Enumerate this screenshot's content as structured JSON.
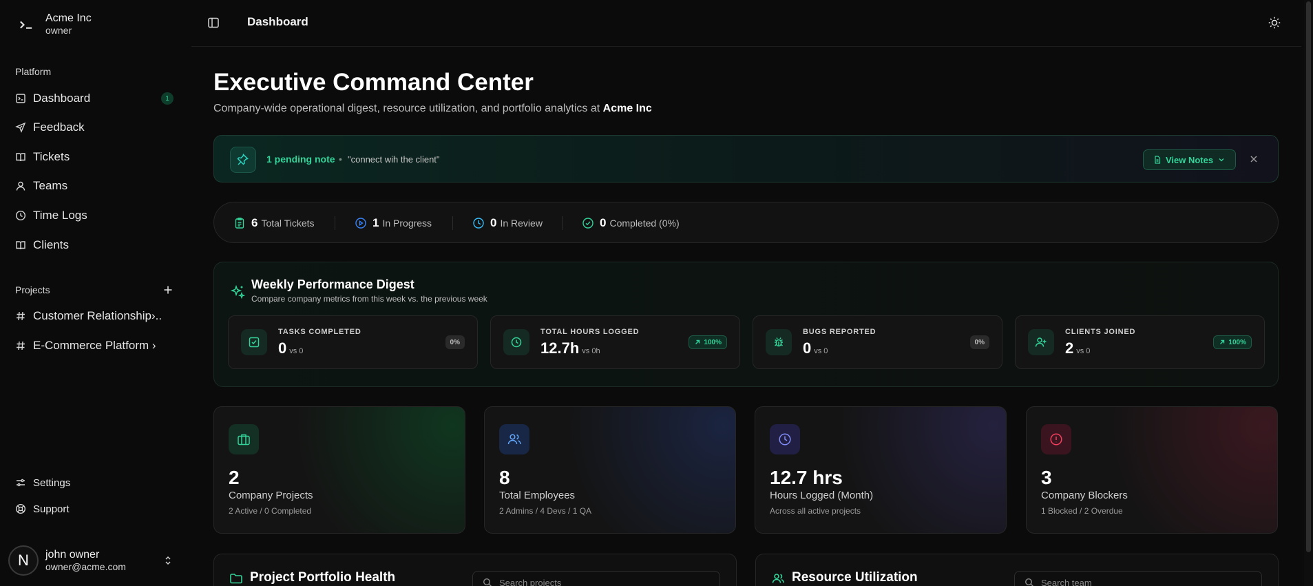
{
  "sidebar": {
    "brand": {
      "name": "Acme Inc",
      "role": "owner"
    },
    "platform_label": "Platform",
    "nav": [
      {
        "label": "Dashboard",
        "icon": "dashboard-icon",
        "badge": "1"
      },
      {
        "label": "Feedback",
        "icon": "send-icon"
      },
      {
        "label": "Tickets",
        "icon": "book-icon"
      },
      {
        "label": "Teams",
        "icon": "user-icon"
      },
      {
        "label": "Time Logs",
        "icon": "clock-icon"
      },
      {
        "label": "Clients",
        "icon": "book-icon"
      }
    ],
    "projects_label": "Projects",
    "projects": [
      {
        "label": "Customer Relationship›.."
      },
      {
        "label": "E-Commerce Platform ›"
      }
    ],
    "footer": [
      {
        "label": "Settings",
        "icon": "settings-icon"
      },
      {
        "label": "Support",
        "icon": "support-icon"
      }
    ],
    "user": {
      "initial": "N",
      "name": "john owner",
      "email": "owner@acme.com"
    }
  },
  "topbar": {
    "title": "Dashboard"
  },
  "header": {
    "title": "Executive Command Center",
    "subtitle_prefix": "Company-wide operational digest, resource utilization, and portfolio analytics at ",
    "subtitle_company": "Acme Inc"
  },
  "notes": {
    "count_text": "1 pending note",
    "separator": "•",
    "preview": "\"connect wih the client\"",
    "button_label": "View Notes"
  },
  "ticket_stats": [
    {
      "value": "6",
      "label": "Total Tickets",
      "color": "#34d399"
    },
    {
      "value": "1",
      "label": "In Progress",
      "color": "#3b82f6"
    },
    {
      "value": "0",
      "label": "In Review",
      "color": "#38bdf8"
    },
    {
      "value": "0",
      "label": "Completed (0%)",
      "color": "#34d399"
    }
  ],
  "digest": {
    "title": "Weekly Performance Digest",
    "subtitle": "Compare company metrics from this week vs. the previous week",
    "metrics": [
      {
        "label": "TASKS COMPLETED",
        "value": "0",
        "vs": "vs 0",
        "change": "0%",
        "trend": "neutral"
      },
      {
        "label": "TOTAL HOURS LOGGED",
        "value": "12.7h",
        "vs": "vs 0h",
        "change": "100%",
        "trend": "up"
      },
      {
        "label": "BUGS REPORTED",
        "value": "0",
        "vs": "vs 0",
        "change": "0%",
        "trend": "neutral"
      },
      {
        "label": "CLIENTS JOINED",
        "value": "2",
        "vs": "vs 0",
        "change": "100%",
        "trend": "up"
      }
    ]
  },
  "kpis": [
    {
      "value": "2",
      "label": "Company Projects",
      "sub": "2 Active / 0 Completed",
      "accent": "#34d399"
    },
    {
      "value": "8",
      "label": "Total Employees",
      "sub": "2 Admins / 4 Devs / 1 QA",
      "accent": "#60a5fa"
    },
    {
      "value": "12.7 hrs",
      "label": "Hours Logged (Month)",
      "sub": "Across all active projects",
      "accent": "#818cf8"
    },
    {
      "value": "3",
      "label": "Company Blockers",
      "sub": "1 Blocked / 2 Overdue",
      "accent": "#f43f5e"
    }
  ],
  "panels": {
    "portfolio": {
      "title": "Project Portfolio Health",
      "search_placeholder": "Search projects"
    },
    "resources": {
      "title": "Resource Utilization",
      "search_placeholder": "Search team"
    }
  }
}
